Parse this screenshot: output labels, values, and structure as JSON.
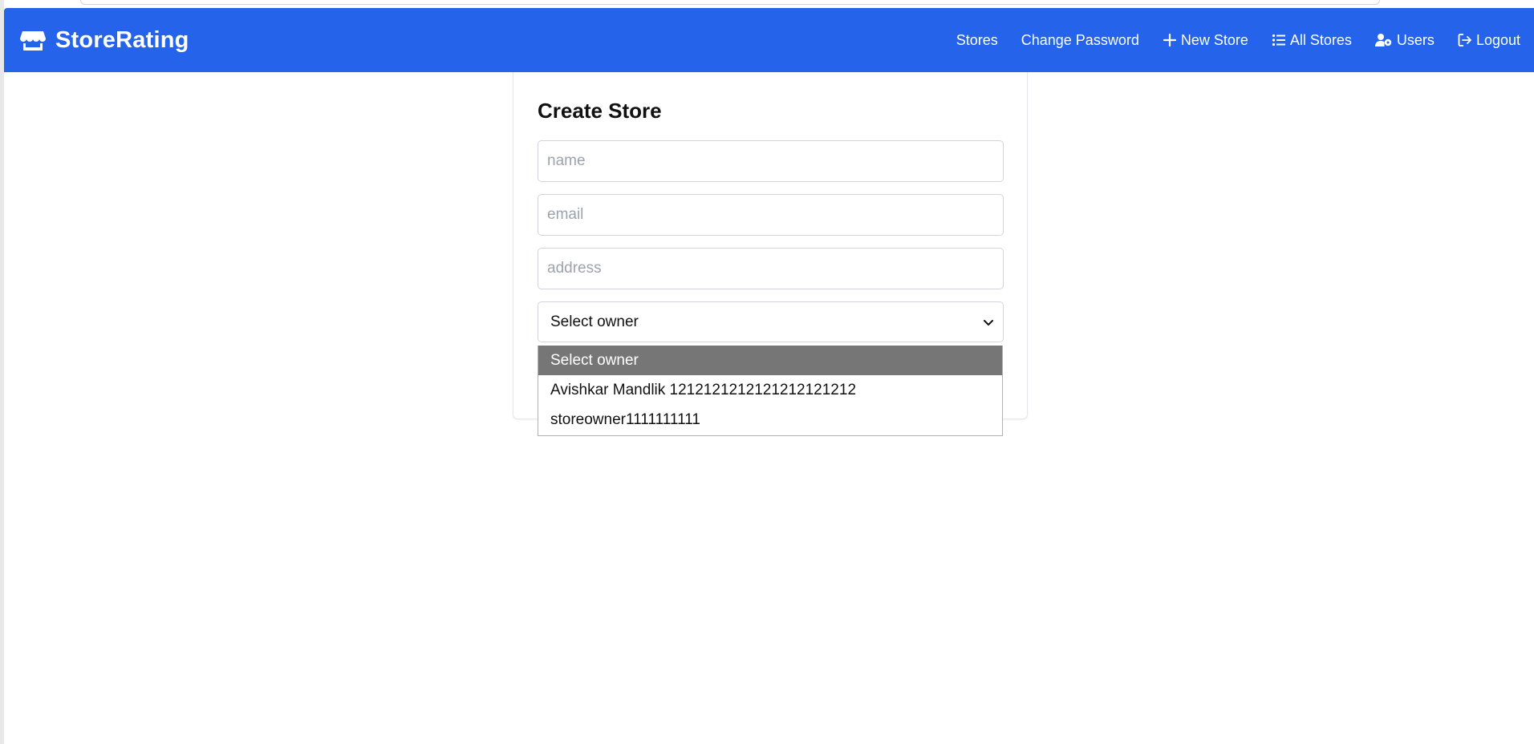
{
  "brand": {
    "name": "StoreRating",
    "icon": "store-icon"
  },
  "nav": {
    "links": [
      {
        "label": "Stores",
        "icon": ""
      },
      {
        "label": "Change Password",
        "icon": ""
      },
      {
        "label": "New Store",
        "icon": "plus-icon"
      },
      {
        "label": "All Stores",
        "icon": "list-icon"
      },
      {
        "label": "Users",
        "icon": "users-gear-icon"
      },
      {
        "label": "Logout",
        "icon": "logout-icon"
      }
    ]
  },
  "form": {
    "title": "Create Store",
    "name_placeholder": "name",
    "email_placeholder": "email",
    "address_placeholder": "address",
    "owner_select": {
      "selected": "Select owner",
      "options": [
        "Select owner",
        "Avishkar Mandlik 1212121212121212121212",
        "storeowner1111111111"
      ]
    }
  },
  "colors": {
    "navbar": "#2563eb",
    "option_highlight": "#767676"
  }
}
